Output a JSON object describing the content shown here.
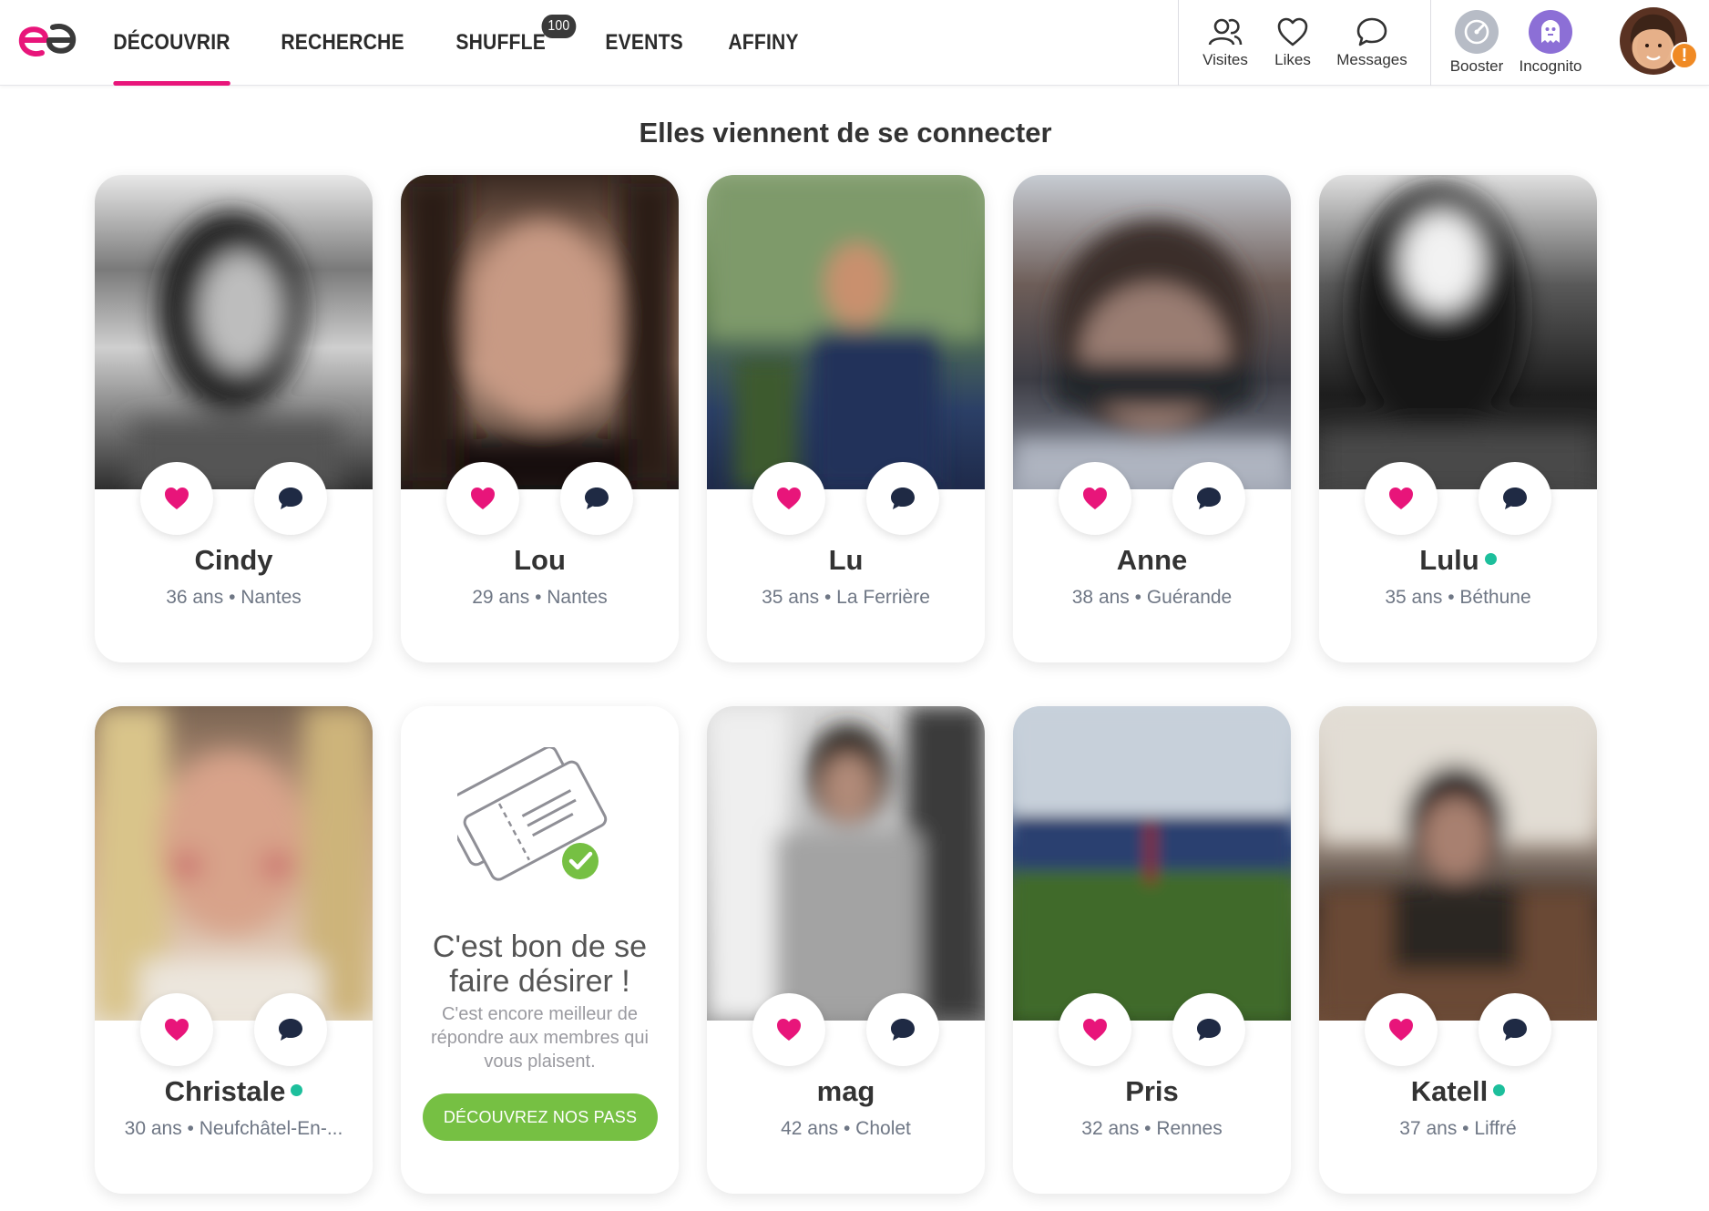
{
  "nav": {
    "items": [
      {
        "label": "DÉCOUVRIR",
        "active": true
      },
      {
        "label": "RECHERCHE",
        "active": false
      },
      {
        "label": "SHUFFLE",
        "active": false,
        "badge": "100"
      },
      {
        "label": "EVENTS",
        "active": false
      },
      {
        "label": "AFFINY",
        "active": false
      }
    ]
  },
  "tools": {
    "visites": "Visites",
    "likes": "Likes",
    "messages": "Messages",
    "booster": "Booster",
    "incognito": "Incognito"
  },
  "colors": {
    "brand": "#e8157a",
    "online": "#1dbf9c",
    "promo_button": "#76c043",
    "incognito": "#8c6fd6"
  },
  "avatar_alert": "!",
  "heading": "Elles viennent de se connecter",
  "profiles": [
    {
      "name": "Cindy",
      "meta": "36 ans • Nantes",
      "online": false
    },
    {
      "name": "Lou",
      "meta": "29 ans • Nantes",
      "online": false
    },
    {
      "name": "Lu",
      "meta": "35 ans • La Ferrière",
      "online": false
    },
    {
      "name": "Anne",
      "meta": "38 ans • Guérande",
      "online": false
    },
    {
      "name": "Lulu",
      "meta": "35 ans • Béthune",
      "online": true
    },
    {
      "name": "Christale",
      "meta": "30 ans • Neufchâtel-En-...",
      "online": true
    },
    {
      "name": "mag",
      "meta": "42 ans • Cholet",
      "online": false
    },
    {
      "name": "Pris",
      "meta": "32 ans • Rennes",
      "online": false
    },
    {
      "name": "Katell",
      "meta": "37 ans • Liffré",
      "online": true
    }
  ],
  "promo": {
    "title_line1": "C'est bon de se",
    "title_line2": "faire désirer !",
    "subtitle": "C'est encore meilleur de répondre aux membres qui vous plaisent.",
    "button": "DÉCOUVREZ NOS PASS"
  }
}
